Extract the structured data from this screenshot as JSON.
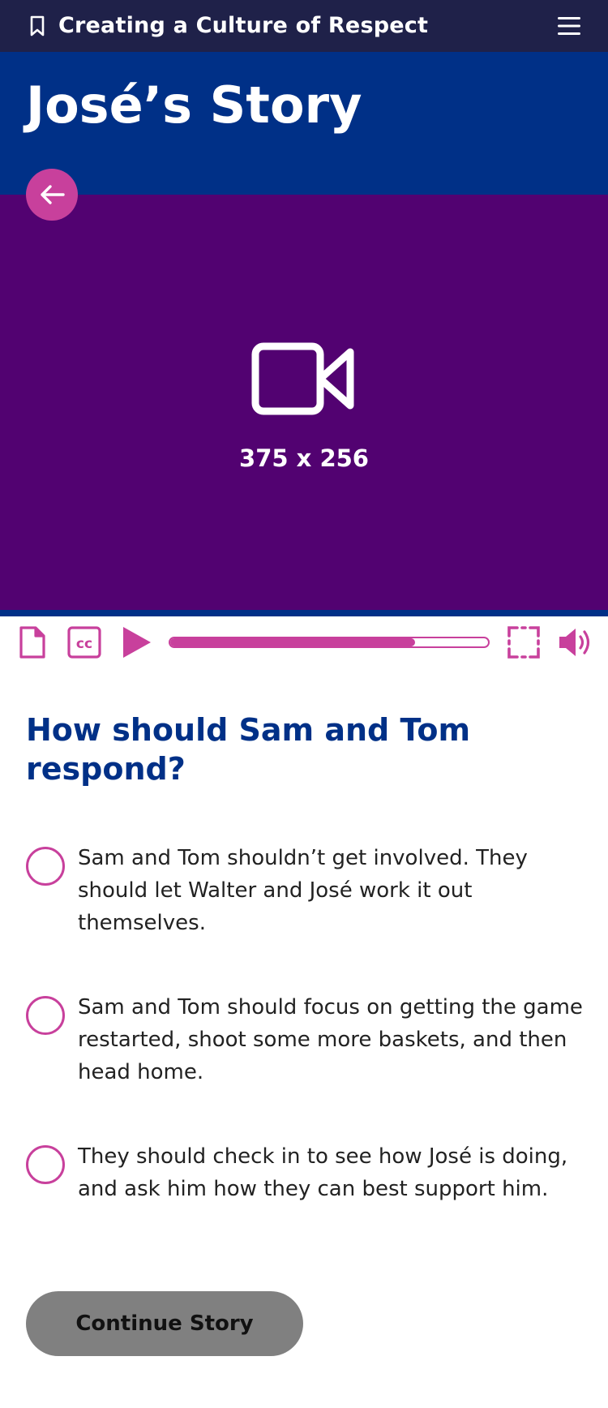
{
  "topbar": {
    "title": "Creating a Culture of Respect",
    "bookmark_icon": "bookmark-icon",
    "menu_icon": "hamburger-menu-icon"
  },
  "header": {
    "title": "José’s Story"
  },
  "back_button": {
    "icon": "arrow-left-icon"
  },
  "video": {
    "placeholder_icon": "video-camera-icon",
    "dimensions_label": "375 x 256"
  },
  "controls": {
    "transcript_icon": "document-icon",
    "captions_icon": "closed-captions-icon",
    "play_icon": "play-icon",
    "progress": 0.77,
    "fullscreen_icon": "fullscreen-icon",
    "volume_icon": "volume-icon"
  },
  "question": {
    "text": "How should Sam and Tom respond?"
  },
  "options": [
    {
      "text": "Sam and Tom shouldn’t get involved. They should let Walter and José work it out themselves."
    },
    {
      "text": "Sam and Tom should focus on getting the game restarted, shoot some more baskets, and then head home."
    },
    {
      "text": "They should check in to see how José is doing, and ask him how they can best support him."
    }
  ],
  "continue_button": {
    "label": "Continue Story"
  },
  "colors": {
    "topbar": "#1f2149",
    "header": "#003087",
    "video": "#520271",
    "accent": "#c8409c",
    "button": "#808080"
  }
}
